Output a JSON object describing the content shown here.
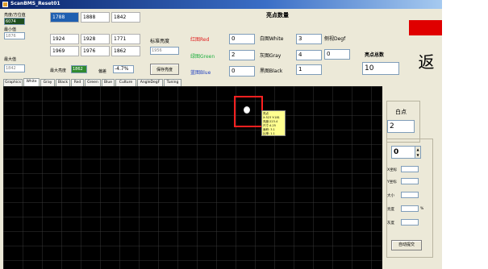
{
  "window": {
    "title": "ScanBMS_Reset01"
  },
  "left_panel": {
    "label_top": "亮度/方位值",
    "value_top": "6074",
    "label_min": "最小值",
    "value_min": "1876",
    "label_max": "最大值",
    "value_max": "1842"
  },
  "grid_values": [
    [
      "1788",
      "1888",
      "1842"
    ],
    [
      "1924",
      "1928",
      "1771"
    ],
    [
      "1969",
      "1976",
      "1862"
    ]
  ],
  "mid": {
    "std_label": "标准亮度",
    "std_value": "1956",
    "cal_label": "最大亮度",
    "cal_value": "1862",
    "dev_label": "偏差",
    "dev_value": "-4.7%",
    "save_button": "保存亮度"
  },
  "counts": {
    "title": "亮点数量",
    "red_label": "红图Red",
    "red_value": "0",
    "green_label": "绿图Green",
    "green_value": "2",
    "blue_label": "蓝图Blue",
    "blue_value": "0",
    "white_label": "白图White",
    "white_value": "3",
    "gray_label": "灰图Gray",
    "gray_value": "4",
    "black_label": "黑图Black",
    "black_value": "1",
    "slant_label": "侧视Degf",
    "slant_value": "0",
    "total_label": "亮点总数",
    "total_value": "10",
    "return_button": "返"
  },
  "tabs": [
    "Graphics",
    "White",
    "Gray",
    "Black",
    "Red",
    "Green",
    "Blue",
    "Culture",
    "AngleDegF",
    "Tuning"
  ],
  "active_tab": "White",
  "overlay_tooltip": [
    "亮点",
    "X:523  Y:181",
    "亮度:223.4",
    "尺寸:4.25",
    "面积: 3.1",
    "比率: 1.1"
  ],
  "right": {
    "white_label": "白点",
    "white_value": "2",
    "spinner_value": "0",
    "rows": [
      "X坐标",
      "Y坐标",
      "大小",
      "亮度",
      "灰度"
    ],
    "percent": "%",
    "action_button": "自动提交"
  },
  "colors": {
    "red_label": "#e02020",
    "green_label": "#20b040",
    "blue_label": "#2040c0",
    "alert_red": "#e00000",
    "marker": "#ff2020",
    "tooltip_bg": "#ffff90"
  }
}
